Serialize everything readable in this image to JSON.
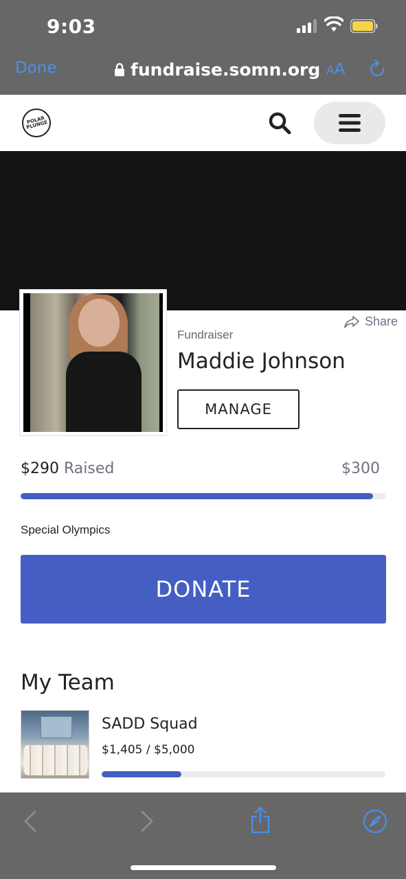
{
  "status_bar": {
    "time": "9:03"
  },
  "browser": {
    "done_label": "Done",
    "url": "fundraise.somn.org",
    "text_size_small": "A",
    "text_size_big": "A",
    "accent_color": "#4a90e8"
  },
  "site": {
    "logo_text": "POLAR PLUNGE"
  },
  "profile": {
    "share_label": "Share",
    "role_label": "Fundraiser",
    "name": "Maddie Johnson",
    "manage_label": "MANAGE"
  },
  "progress": {
    "raised_amount": "$290",
    "raised_label": "Raised",
    "goal": "$300",
    "fraction": 0.967,
    "bar_color": "#455ec4"
  },
  "organization": "Special Olympics",
  "donate_label": "DONATE",
  "team": {
    "heading": "My Team",
    "name": "SADD Squad",
    "amount": "$1,405 / $5,000",
    "fraction": 0.281
  }
}
